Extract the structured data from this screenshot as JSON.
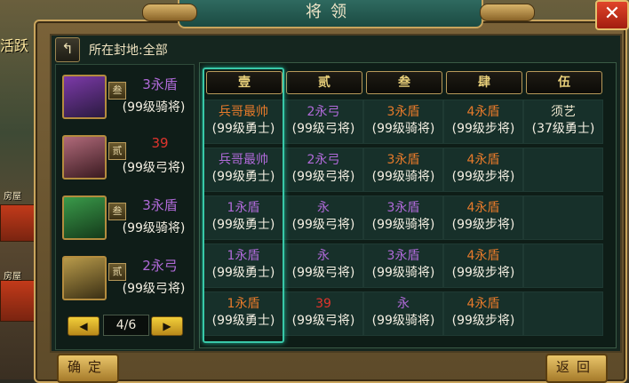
{
  "dialog": {
    "title": "将领",
    "close_label": "✕"
  },
  "location_label": "所在封地:全部",
  "side_labels": [
    "活跃",
    "房屋",
    "房屋"
  ],
  "column_headers": [
    "壹",
    "贰",
    "叁",
    "肆",
    "伍"
  ],
  "grid": [
    [
      {
        "name": "兵哥最帅",
        "level": "(99级勇士)",
        "color": "orange"
      },
      {
        "name": "2永弓",
        "level": "(99级弓将)",
        "color": "purple"
      },
      {
        "name": "3永盾",
        "level": "(99级骑将)",
        "color": "orange"
      },
      {
        "name": "4永盾",
        "level": "(99级步将)",
        "color": "orange"
      },
      {
        "name": "须艺",
        "level": "(37级勇士)",
        "color": "cream"
      }
    ],
    [
      {
        "name": "兵哥最帅",
        "level": "(99级勇士)",
        "color": "purple"
      },
      {
        "name": "2永弓",
        "level": "(99级弓将)",
        "color": "purple"
      },
      {
        "name": "3永盾",
        "level": "(99级骑将)",
        "color": "orange"
      },
      {
        "name": "4永盾",
        "level": "(99级步将)",
        "color": "orange"
      },
      null
    ],
    [
      {
        "name": "1永盾",
        "level": "(99级勇士)",
        "color": "purple"
      },
      {
        "name": "永",
        "level": "(99级弓将)",
        "color": "purple"
      },
      {
        "name": "3永盾",
        "level": "(99级骑将)",
        "color": "purple"
      },
      {
        "name": "4永盾",
        "level": "(99级步将)",
        "color": "orange"
      },
      null
    ],
    [
      {
        "name": "1永盾",
        "level": "(99级勇士)",
        "color": "purple"
      },
      {
        "name": "永",
        "level": "(99级弓将)",
        "color": "purple"
      },
      {
        "name": "3永盾",
        "level": "(99级骑将)",
        "color": "purple"
      },
      {
        "name": "4永盾",
        "level": "(99级步将)",
        "color": "orange"
      },
      null
    ],
    [
      {
        "name": "1永盾",
        "level": "(99级勇士)",
        "color": "orange"
      },
      {
        "name": "39",
        "level": "(99级弓将)",
        "color": "red"
      },
      {
        "name": "永",
        "level": "(99级骑将)",
        "color": "purple"
      },
      {
        "name": "4永盾",
        "level": "(99级步将)",
        "color": "orange"
      },
      null
    ]
  ],
  "generals": [
    {
      "name": "3永盾",
      "rank": "叁",
      "level": "(99级骑将)",
      "color": "purple",
      "portrait": "male-general-portrait"
    },
    {
      "name": "39",
      "rank": "贰",
      "level": "(99级弓将)",
      "color": "red",
      "portrait": "female-general-portrait"
    },
    {
      "name": "3永盾",
      "rank": "叁",
      "level": "(99级骑将)",
      "color": "purple",
      "portrait": "green-general-portrait"
    },
    {
      "name": "2永弓",
      "rank": "贰",
      "level": "(99级弓将)",
      "color": "purple",
      "portrait": "old-general-portrait"
    }
  ],
  "pagination": {
    "label": "4/6",
    "prev": "◀",
    "next": "▶"
  },
  "buttons": {
    "confirm": "确定",
    "back": "返回"
  },
  "colors": {
    "purple": "#b06ad9",
    "orange": "#e77a2a",
    "red": "#e0342d",
    "selected_border": "#38c8a8"
  }
}
